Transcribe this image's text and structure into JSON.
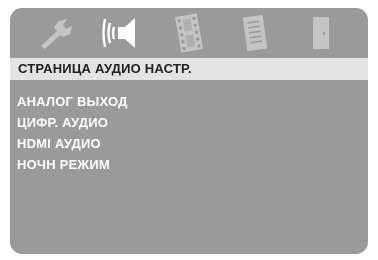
{
  "menu_bar": {
    "tabs": [
      {
        "icon": "wrench-icon",
        "label": ""
      },
      {
        "icon": "speaker-icon",
        "label": ""
      },
      {
        "icon": "film-icon",
        "label": ""
      },
      {
        "icon": "document-icon",
        "label": ""
      },
      {
        "icon": "door-icon",
        "label": ""
      }
    ],
    "selected_tab": "speaker-icon"
  },
  "page": {
    "title": "СТРАНИЦА АУДИО НАСТР."
  },
  "menu": {
    "items": [
      {
        "label": "АНАЛОГ ВЫХОД"
      },
      {
        "label": "ЦИФР. АУДИО"
      },
      {
        "label": "HDMI АУДИО"
      },
      {
        "label": "НОЧН РЕЖИМ"
      }
    ]
  },
  "colors": {
    "panel_background": "#9a9a9a",
    "title_bar": "#e3e3e3",
    "icon_fill": "#c4c4c4",
    "selected_icon": "#ffffff",
    "menu_text": "#ffffff",
    "title_text": "#222222"
  }
}
